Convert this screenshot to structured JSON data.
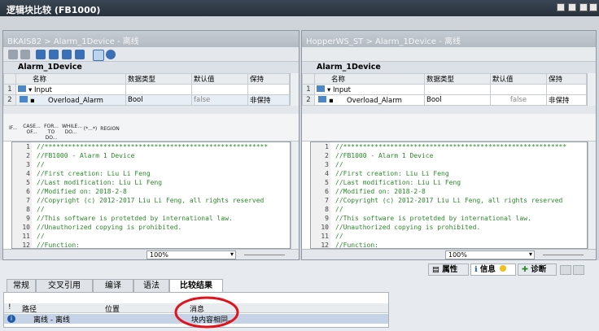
{
  "window": {
    "title": "逻辑块比较 (FB1000)"
  },
  "left": {
    "header": "BKAIS82 > Alarm_1Device - 离线",
    "block_name": "Alarm_1Device",
    "columns": [
      "名称",
      "数据类型",
      "默认值",
      "保持"
    ],
    "row1": {
      "num": "1",
      "name": "Input"
    },
    "row2": {
      "num": "2",
      "name": "Overload_Alarm",
      "type": "Bool",
      "default": "false",
      "retain": "非保持"
    },
    "zoom": "100%"
  },
  "right": {
    "header": "HopperWS_ST > Alarm_1Device - 离线",
    "block_name": "Alarm_1Device",
    "columns": [
      "名称",
      "数据类型",
      "默认值",
      "保持"
    ],
    "row1": {
      "num": "1",
      "name": "Input"
    },
    "row2": {
      "num": "2",
      "name": "Overload_Alarm",
      "type": "Bool",
      "default": "false",
      "retain": "非保持"
    },
    "zoom": "100%"
  },
  "instructions": [
    "IF...",
    "CASE... OF...",
    "FOR... TO DO...",
    "WHILE... DO...",
    "(*...*)",
    "REGION"
  ],
  "code": {
    "lines": [
      {
        "n": "1",
        "t": "//*********************************************************"
      },
      {
        "n": "2",
        "t": "//FB1000 - Alarm 1 Device"
      },
      {
        "n": "3",
        "t": "//"
      },
      {
        "n": "4",
        "t": "//First creation: Liu Li Feng"
      },
      {
        "n": "5",
        "t": "//Last modification: Liu Li Feng"
      },
      {
        "n": "6",
        "t": "//Modified on: 2018-2-8"
      },
      {
        "n": "7",
        "t": "//Copyright (c) 2012-2017 Liu Li Feng, all rights reserved"
      },
      {
        "n": "8",
        "t": "//"
      },
      {
        "n": "9",
        "t": "//This software is protetded by international law."
      },
      {
        "n": "10",
        "t": "//Unauthorized copying is prohibited."
      },
      {
        "n": "11",
        "t": "//"
      },
      {
        "n": "12",
        "t": "//Function:"
      }
    ]
  },
  "inspector": {
    "properties": "属性",
    "info": "信息",
    "diagnostics": "诊断"
  },
  "tabs": [
    "常规",
    "交叉引用",
    "编译",
    "语法",
    "比较结果"
  ],
  "results": {
    "columns": [
      "路径",
      "位置",
      "消息"
    ],
    "row": {
      "path": "离线 - 离线",
      "position": "",
      "message": "块内容相同。"
    }
  },
  "colors": {
    "annotation": "#e0141e",
    "code_comment": "#2a8a2a",
    "title_bar": "#27313c"
  }
}
